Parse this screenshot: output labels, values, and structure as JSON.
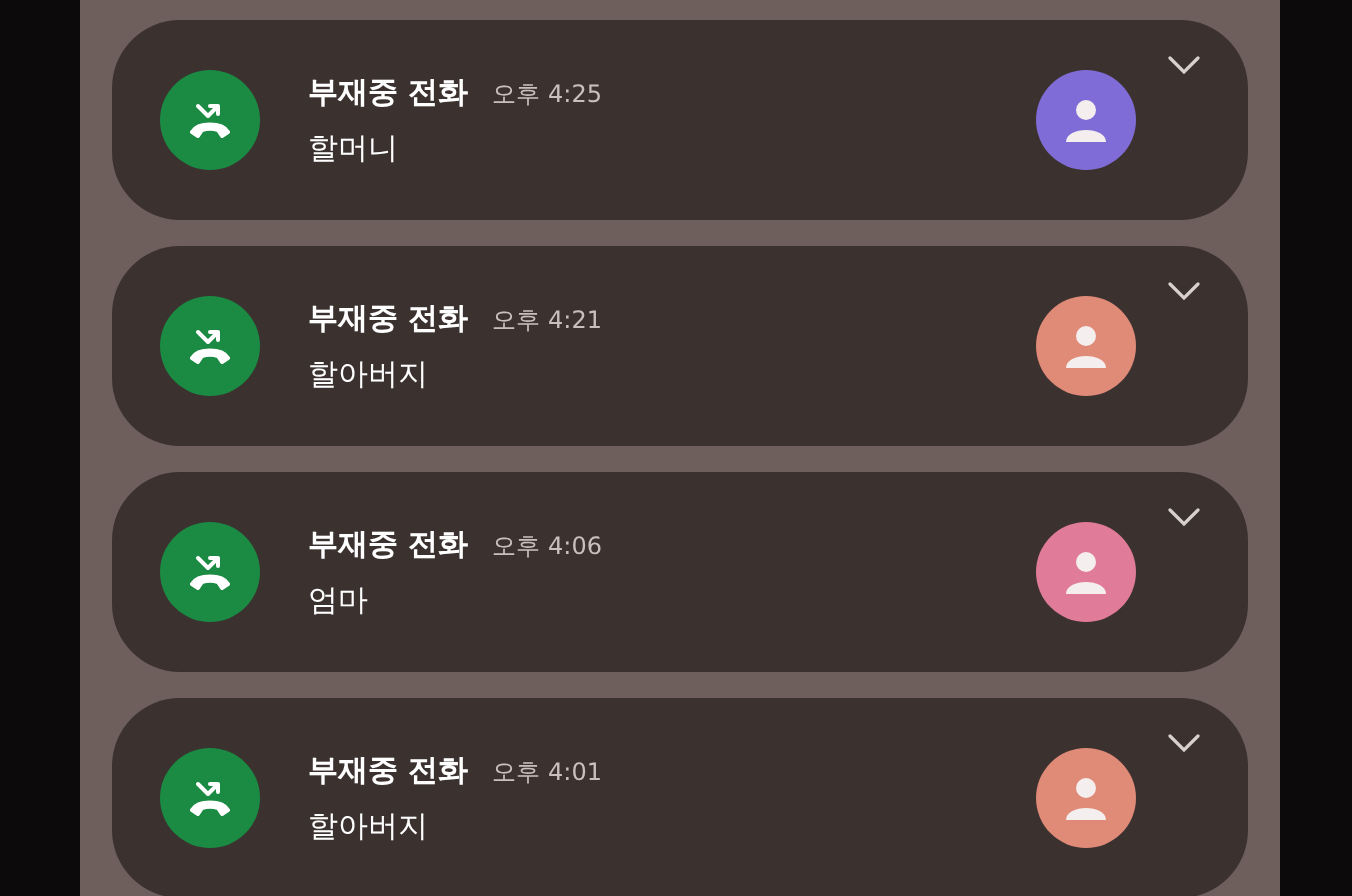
{
  "notifications": [
    {
      "title": "부재중 전화",
      "time": "오후 4:25",
      "caller": "할머니",
      "color": "#7f6cd6"
    },
    {
      "title": "부재중 전화",
      "time": "오후 4:21",
      "caller": "할아버지",
      "color": "#e08a78"
    },
    {
      "title": "부재중 전화",
      "time": "오후 4:06",
      "caller": "엄마",
      "color": "#e07b9a"
    },
    {
      "title": "부재중 전화",
      "time": "오후 4:01",
      "caller": "할아버지",
      "color": "#e08a78"
    }
  ]
}
